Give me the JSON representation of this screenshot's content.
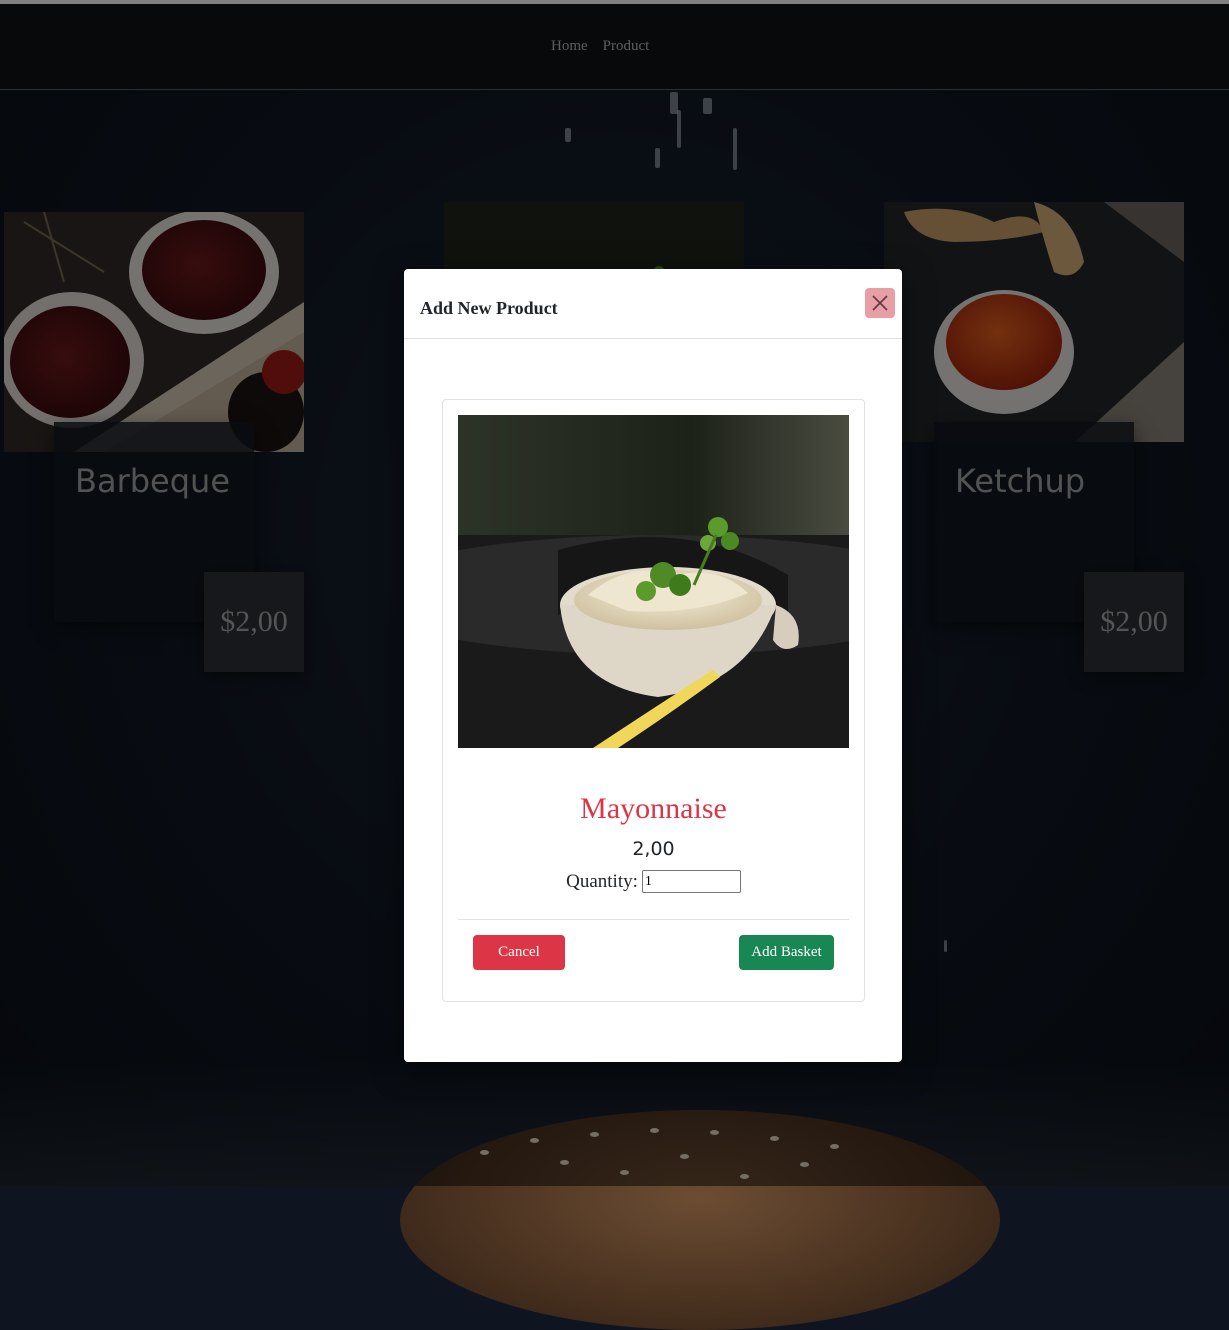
{
  "nav": {
    "links": [
      "Home",
      "Product"
    ]
  },
  "products": [
    {
      "name": "Barbeque",
      "price": "$2,00",
      "image": "bbq-sauce-photo"
    },
    {
      "name": "Ketchup",
      "price": "$2,00",
      "image": "ketchup-dip-photo"
    }
  ],
  "modal": {
    "title": "Add New Product",
    "close_icon": "close-icon",
    "product_image": "mayonnaise-dip-photo",
    "product_name": "Mayonnaise",
    "product_price": "2,00",
    "quantity_label": "Quantity:",
    "quantity_value": "1",
    "cancel_label": "Cancel",
    "add_label": "Add Basket"
  },
  "colors": {
    "navbar": "#111214",
    "page_background": "#0e1520",
    "danger": "#dc3545",
    "success": "#198754",
    "close_button": "#e79ea4"
  }
}
